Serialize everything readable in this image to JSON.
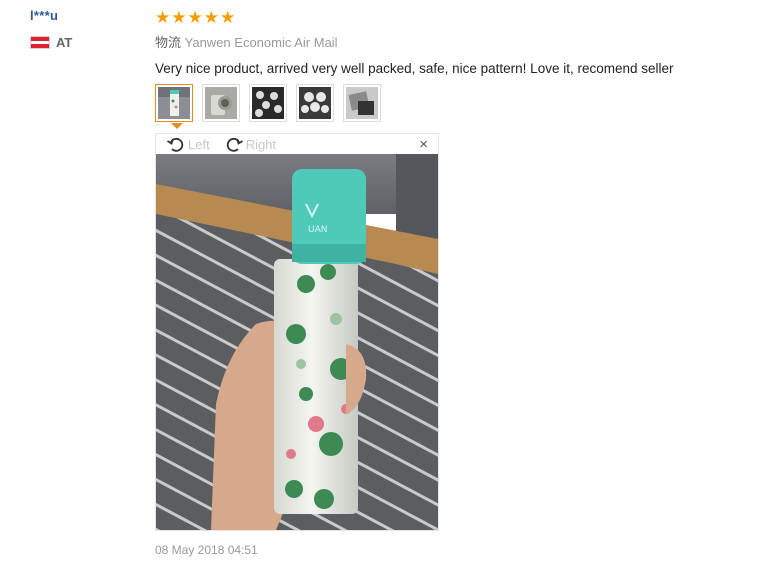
{
  "reviewer": {
    "name": "l***u",
    "country_code": "AT",
    "flag_colors": [
      "#e31e2d",
      "#ffffff",
      "#e31e2d"
    ]
  },
  "review": {
    "rating": 5,
    "rating_max": 5,
    "star_color": "#f39c00",
    "shipping_label": "物流",
    "shipping_method": "Yanwen Economic Air Mail",
    "text": "Very nice product, arrived very well packed, safe, nice pattern! Love it, recomend seller",
    "date": "08 May 2018 04:51"
  },
  "thumbnails": [
    {
      "name": "thumb-bottle-hand",
      "active": true
    },
    {
      "name": "thumb-bottle-cup",
      "active": false
    },
    {
      "name": "thumb-pattern-closeup",
      "active": false
    },
    {
      "name": "thumb-pattern-hex",
      "active": false
    },
    {
      "name": "thumb-package",
      "active": false
    }
  ],
  "viewer": {
    "rotate_left_label": "Left",
    "rotate_right_label": "Right",
    "close_symbol": "×",
    "accent_color": "#e88b1a"
  },
  "photo": {
    "bottle_logo_text": "UAN",
    "cap_color": "#4fc9b8"
  }
}
